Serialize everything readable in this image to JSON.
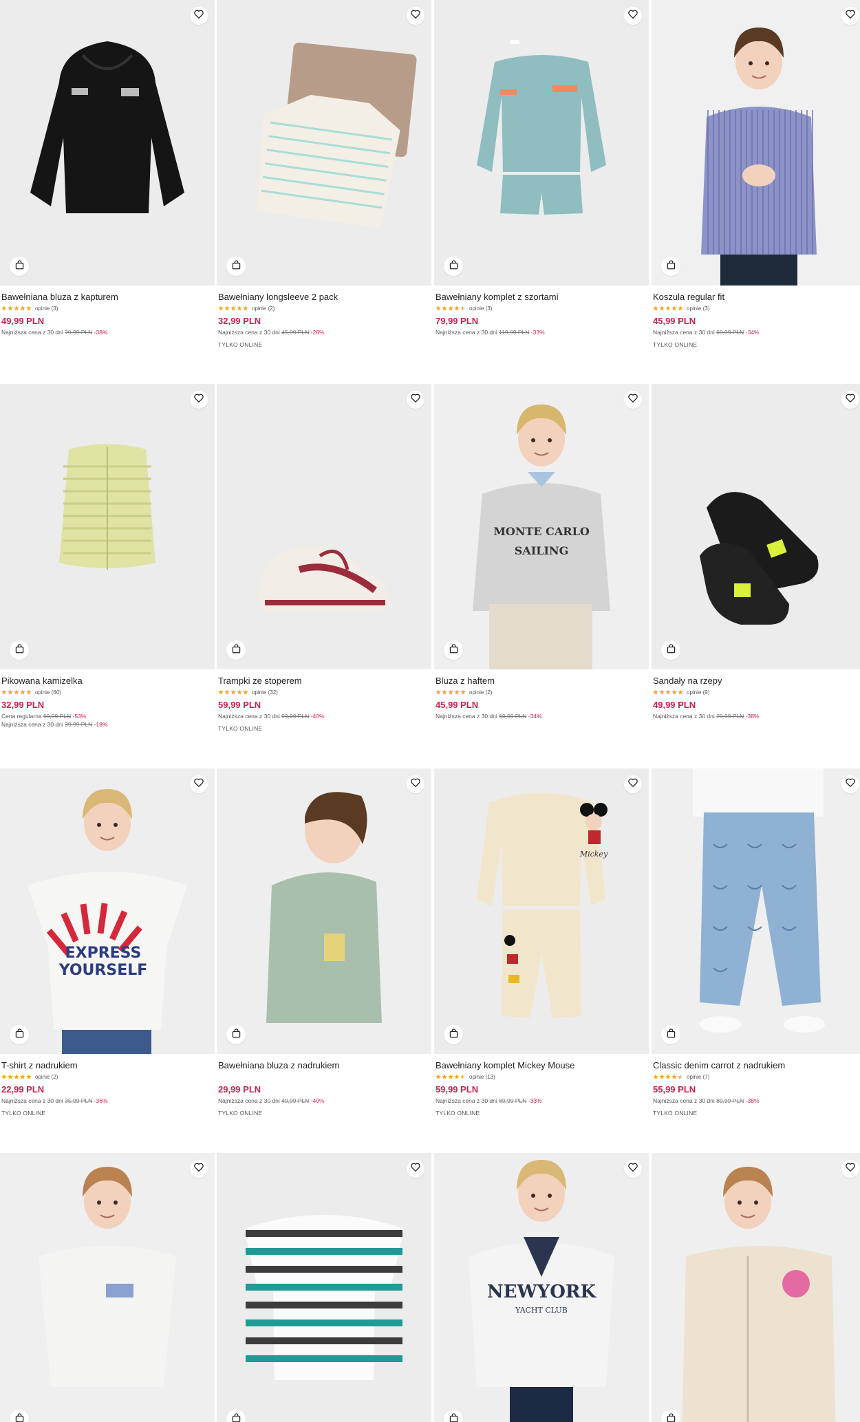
{
  "colors": {
    "price": "#d41e4f",
    "star": "#f5a623",
    "image_bg": "#ececec"
  },
  "icons": {
    "favorite": "heart-outline-icon",
    "cart": "shopping-bag-icon",
    "rating": "star-icon"
  },
  "products": [
    {
      "name": "Bawełniana bluza z kapturem",
      "rating_stars": 5,
      "reviews": "opinie (3)",
      "price": "49,99 PLN",
      "lowest_label": "Najniższa cena z 30 dni",
      "lowest_old": "79,99 PLN",
      "lowest_disc": "-38%",
      "online": ""
    },
    {
      "name": "Bawełniany longsleeve 2 pack",
      "rating_stars": 5,
      "reviews": "opinie (2)",
      "price": "32,99 PLN",
      "lowest_label": "Najniższa cena z 30 dni",
      "lowest_old": "45,99 PLN",
      "lowest_disc": "-28%",
      "online": "TYLKO ONLINE"
    },
    {
      "name": "Bawełniany komplet z szortami",
      "rating_stars": 4.5,
      "reviews": "opinie (3)",
      "price": "79,99 PLN",
      "lowest_label": "Najniższa cena z 30 dni",
      "lowest_old": "119,99 PLN",
      "lowest_disc": "-33%",
      "online": ""
    },
    {
      "name": "Koszula regular fit",
      "rating_stars": 5,
      "reviews": "opinie (3)",
      "price": "45,99 PLN",
      "lowest_label": "Najniższa cena z 30 dni",
      "lowest_old": "69,99 PLN",
      "lowest_disc": "-34%",
      "online": "TYLKO ONLINE"
    },
    {
      "name": "Pikowana kamizelka",
      "rating_stars": 5,
      "reviews": "opinie (60)",
      "price": "32,99 PLN",
      "regular_label": "Cena regularna",
      "regular_old": "69,99 PLN",
      "regular_disc": "-53%",
      "lowest_label": "Najniższa cena z 30 dni",
      "lowest_old": "39,99 PLN",
      "lowest_disc": "-18%",
      "online": ""
    },
    {
      "name": "Trampki ze stoperem",
      "rating_stars": 5,
      "reviews": "opinie (32)",
      "price": "59,99 PLN",
      "lowest_label": "Najniższa cena z 30 dni",
      "lowest_old": "99,99 PLN",
      "lowest_disc": "-40%",
      "online": "TYLKO ONLINE"
    },
    {
      "name": "Bluza z haftem",
      "rating_stars": 5,
      "reviews": "opinie (2)",
      "price": "45,99 PLN",
      "lowest_label": "Najniższa cena z 30 dni",
      "lowest_old": "69,99 PLN",
      "lowest_disc": "-34%",
      "online": ""
    },
    {
      "name": "Sandały na rzepy",
      "rating_stars": 5,
      "reviews": "opinie (9)",
      "price": "49,99 PLN",
      "lowest_label": "Najniższa cena z 30 dni",
      "lowest_old": "79,99 PLN",
      "lowest_disc": "-38%",
      "online": ""
    },
    {
      "name": "T-shirt z nadrukiem",
      "rating_stars": 5,
      "reviews": "opinie (2)",
      "price": "22,99 PLN",
      "lowest_label": "Najniższa cena z 30 dni",
      "lowest_old": "35,99 PLN",
      "lowest_disc": "-36%",
      "online": "TYLKO ONLINE"
    },
    {
      "name": "Bawełniana bluza z nadrukiem",
      "rating_stars": 0,
      "reviews": "",
      "price": "29,99 PLN",
      "lowest_label": "Najniższa cena z 30 dni",
      "lowest_old": "49,99 PLN",
      "lowest_disc": "-40%",
      "online": "TYLKO ONLINE"
    },
    {
      "name": "Bawełniany komplet Mickey Mouse",
      "rating_stars": 4.5,
      "reviews": "opinie (13)",
      "price": "59,99 PLN",
      "lowest_label": "Najniższa cena z 30 dni",
      "lowest_old": "89,99 PLN",
      "lowest_disc": "-33%",
      "online": "TYLKO ONLINE"
    },
    {
      "name": "Classic denim carrot z nadrukiem",
      "rating_stars": 4.5,
      "reviews": "opinie (7)",
      "price": "55,99 PLN",
      "lowest_label": "Najniższa cena z 30 dni",
      "lowest_old": "89,99 PLN",
      "lowest_disc": "-38%",
      "online": "TYLKO ONLINE"
    },
    {
      "name": "",
      "partial": true
    },
    {
      "name": "",
      "partial": true
    },
    {
      "name": "",
      "partial": true
    },
    {
      "name": "",
      "partial": true
    }
  ],
  "image_prints": {
    "p8": [
      "EXPRESS",
      "YOURSELF"
    ],
    "p6": [
      "MONTE CARLO",
      "SAILING"
    ],
    "p14": [
      "NEWYORK",
      "YACHT CLUB"
    ],
    "p10": [
      "Mickey"
    ]
  }
}
